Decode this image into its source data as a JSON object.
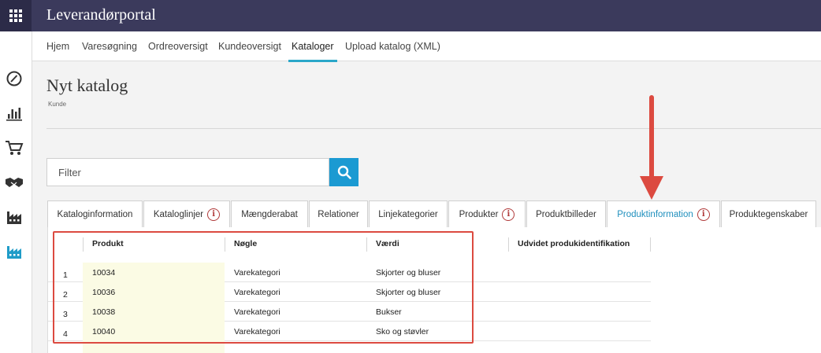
{
  "app": {
    "title": "Leverandørportal"
  },
  "nav": {
    "items": [
      {
        "label": "Hjem"
      },
      {
        "label": "Varesøgning"
      },
      {
        "label": "Ordreoversigt"
      },
      {
        "label": "Kundeoversigt"
      },
      {
        "label": "Kataloger",
        "active": true
      },
      {
        "label": "Upload katalog (XML)"
      }
    ]
  },
  "page": {
    "title": "Nyt katalog",
    "subtitle": "Kunde"
  },
  "filter": {
    "placeholder": "Filter"
  },
  "tabs": [
    {
      "label": "Kataloginformation",
      "info": false
    },
    {
      "label": "Kataloglinjer",
      "info": true
    },
    {
      "label": "Mængderabat",
      "info": false
    },
    {
      "label": "Relationer",
      "info": false
    },
    {
      "label": "Linjekategorier",
      "info": false
    },
    {
      "label": "Produkter",
      "info": true
    },
    {
      "label": "Produktbilleder",
      "info": false
    },
    {
      "label": "Produktinformation",
      "info": true,
      "active": true
    },
    {
      "label": "Produktegenskaber",
      "info": false
    }
  ],
  "info_glyph": "i",
  "grid": {
    "columns": [
      {
        "label": "Produkt"
      },
      {
        "label": "Nøgle"
      },
      {
        "label": "Værdi"
      },
      {
        "label": "Udvidet produkidentifikation"
      }
    ],
    "rows": [
      {
        "num": "1",
        "produkt": "10034",
        "noegle": "Varekategori",
        "vaerdi": "Skjorter og bluser"
      },
      {
        "num": "2",
        "produkt": "10036",
        "noegle": "Varekategori",
        "vaerdi": "Skjorter og bluser"
      },
      {
        "num": "3",
        "produkt": "10038",
        "noegle": "Varekategori",
        "vaerdi": "Bukser"
      },
      {
        "num": "4",
        "produkt": "10040",
        "noegle": "Varekategori",
        "vaerdi": "Sko og støvler"
      }
    ]
  },
  "colors": {
    "topbar": "#3b3a5c",
    "accent": "#2aa7c9",
    "search_button": "#1b9ad2",
    "annotation": "#dc4a40",
    "info_icon": "#b03a3a"
  },
  "icons": {
    "apps": "apps-grid-icon",
    "rail": [
      "dashboard-gauge-icon",
      "bar-chart-icon",
      "shopping-cart-icon",
      "handshake-icon",
      "factory-icon",
      "factory-active-icon"
    ],
    "search": "search-icon",
    "info": "info-icon"
  }
}
